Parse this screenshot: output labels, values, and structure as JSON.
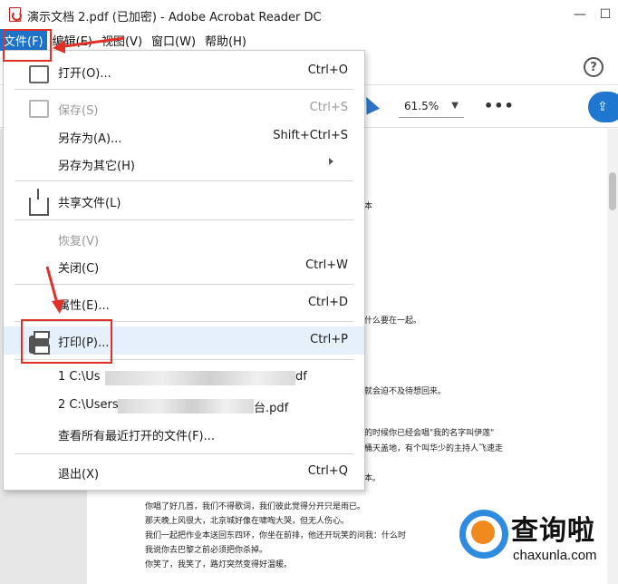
{
  "window": {
    "title": "演示文档 2.pdf  (已加密)  - Adobe Acrobat Reader DC",
    "controls": {
      "minimize": "—",
      "maximize": "☐"
    }
  },
  "menubar": {
    "items": [
      "文件(F)",
      "编辑(E)",
      "视图(V)",
      "窗口(W)",
      "帮助(H)"
    ]
  },
  "toolbar": {
    "zoom": "61.5%",
    "help": "?",
    "more": "•••"
  },
  "file_menu": {
    "open": {
      "label": "打开(O)...",
      "shortcut": "Ctrl+O"
    },
    "save": {
      "label": "保存(S)",
      "shortcut": "Ctrl+S"
    },
    "save_as": {
      "label": "另存为(A)...",
      "shortcut": "Shift+Ctrl+S"
    },
    "save_as_other": {
      "label": "另存为其它(H)"
    },
    "share": {
      "label": "共享文件(L)"
    },
    "revert": {
      "label": "恢复(V)"
    },
    "close": {
      "label": "关闭(C)",
      "shortcut": "Ctrl+W"
    },
    "properties": {
      "label": "属性(E)...",
      "shortcut": "Ctrl+D"
    },
    "print": {
      "label": "打印(P)...",
      "shortcut": "Ctrl+P"
    },
    "recent_1": {
      "prefix": "1 C:\\Us",
      "suffix": "df"
    },
    "recent_2": {
      "prefix": "2 C:\\Users",
      "suffix": "台.pdf"
    },
    "view_all_recent": {
      "label": "查看所有最近打开的文件(F)..."
    },
    "exit": {
      "label": "退出(X)",
      "shortcut": "Ctrl+Q"
    }
  },
  "document": {
    "lines": [
      "本",
      "什么要在一起。",
      "就会迫不及待想回来。",
      "的时候你已经会唱\"我的名字叫伊莲\"",
      "桶天盖地，有个叫华少的主持人飞速走",
      "本。",
      "你唱了好几首，我们不得歌词，我们彼此觉得分开只是雨已。",
      "那天晚上风很大，北京城好像在啸啕大哭，但无人伤心。",
      "我们一起把作业本送回东四环，你坐在前排，他还开玩笑的问我：什么时",
      "我说你去巴黎之前必须把你杀掉。",
      "你笑了，我笑了，路灯突然变得好温暖。"
    ]
  },
  "watermark": {
    "title": "查询啦",
    "domain": "chaxunla.com"
  }
}
